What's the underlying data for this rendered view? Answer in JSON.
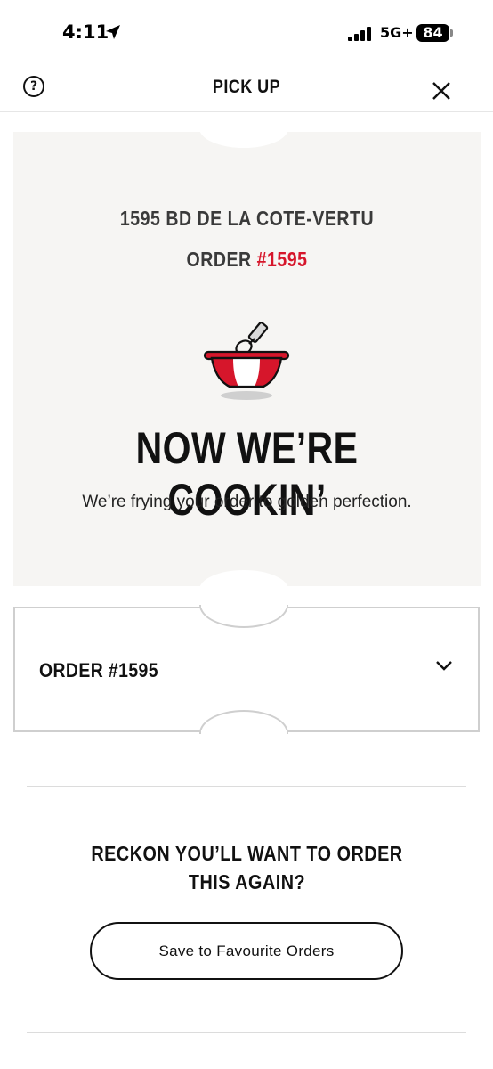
{
  "status_bar": {
    "time": "4:11",
    "network": "5G+",
    "battery": "84"
  },
  "header": {
    "title": "PICK UP",
    "help_icon": "?"
  },
  "ticket": {
    "store_address": "1595 BD DE LA COTE-VERTU",
    "order_prefix": "ORDER ",
    "order_number": "#1595",
    "headline": "NOW WE’RE COOKIN’",
    "subtext": "We’re frying your order to golden perfection.",
    "accent_color": "#d6162b",
    "icon": "mixing-bowl-icon"
  },
  "order_details": {
    "title": "ORDER #1595",
    "expand_icon": "chevron-down-icon"
  },
  "reorder": {
    "line1": "RECKON YOU’LL WANT TO ORDER",
    "line2": "THIS AGAIN?",
    "button_label": "Save to Favourite Orders"
  }
}
